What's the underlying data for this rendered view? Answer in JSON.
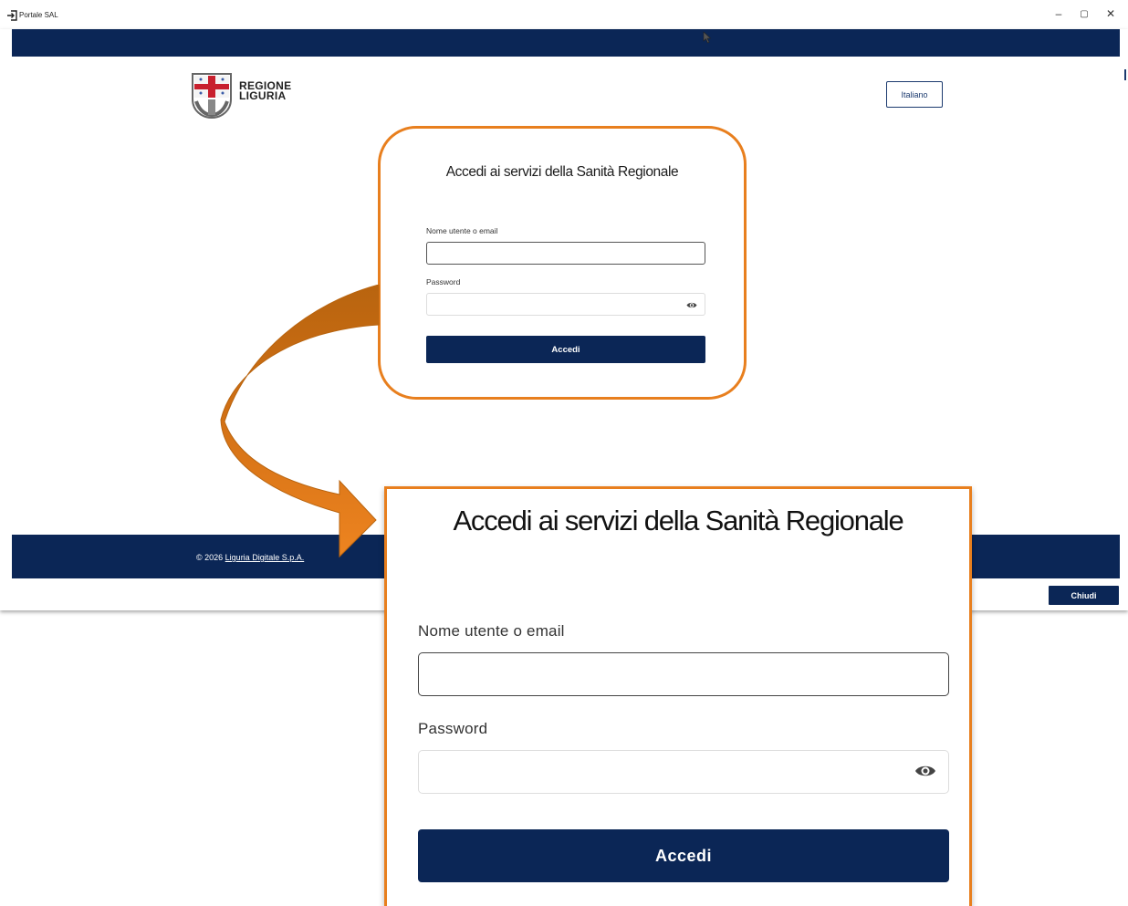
{
  "window": {
    "title": "Portale SAL",
    "minimize_glyph": "–",
    "maximize_glyph": "▢",
    "close_glyph": "✕"
  },
  "header": {
    "logo_line1": "REGIONE",
    "logo_line2": "LIGURIA",
    "language": "Italiano"
  },
  "login": {
    "title": "Accedi ai servizi della Sanità Regionale",
    "username_label": "Nome utente o email",
    "username_value": "",
    "password_label": "Password",
    "password_value": "",
    "submit_label": "Accedi"
  },
  "footer": {
    "copyright_prefix": "© 2026",
    "company_link": "Liguria Digitale S.p.A."
  },
  "actions": {
    "close_label": "Chiudi"
  },
  "colors": {
    "navy": "#0b2656",
    "highlight_orange": "#e87f1e",
    "arrow_dark": "#b8640f"
  },
  "icons": [
    "login-icon",
    "pointer-cursor-icon",
    "coat-of-arms-icon",
    "eye-icon",
    "curved-arrow-icon"
  ]
}
